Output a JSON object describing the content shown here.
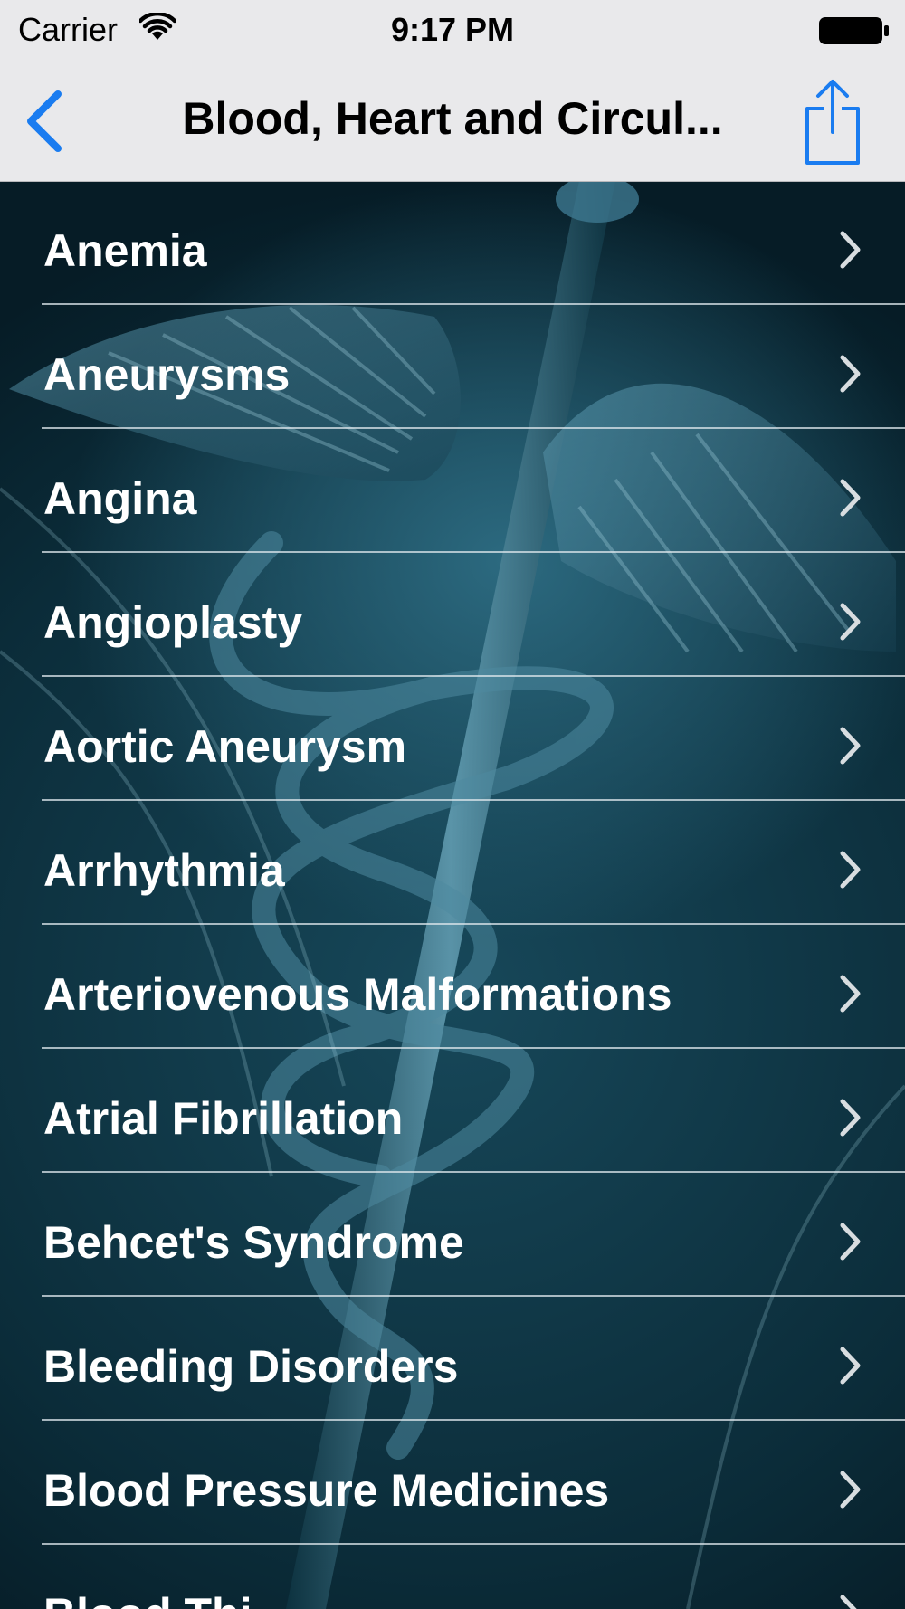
{
  "status_bar": {
    "carrier": "Carrier",
    "time": "9:17 PM",
    "wifi_icon": "wifi-icon",
    "battery_icon": "battery-icon"
  },
  "nav": {
    "back_icon": "chevron-left-icon",
    "title": "Blood, Heart and Circul...",
    "share_icon": "share-icon",
    "tint_color": "#1a7cf0"
  },
  "list": {
    "items": [
      {
        "label": "Anemia"
      },
      {
        "label": "Aneurysms"
      },
      {
        "label": "Angina"
      },
      {
        "label": "Angioplasty"
      },
      {
        "label": "Aortic Aneurysm"
      },
      {
        "label": "Arrhythmia"
      },
      {
        "label": "Arteriovenous Malformations"
      },
      {
        "label": "Atrial Fibrillation"
      },
      {
        "label": "Behcet's Syndrome"
      },
      {
        "label": "Bleeding Disorders"
      },
      {
        "label": "Blood Pressure Medicines"
      },
      {
        "label": "Blood Thi"
      }
    ],
    "chevron_icon": "chevron-right-icon",
    "background_image": "caduceus-background"
  }
}
